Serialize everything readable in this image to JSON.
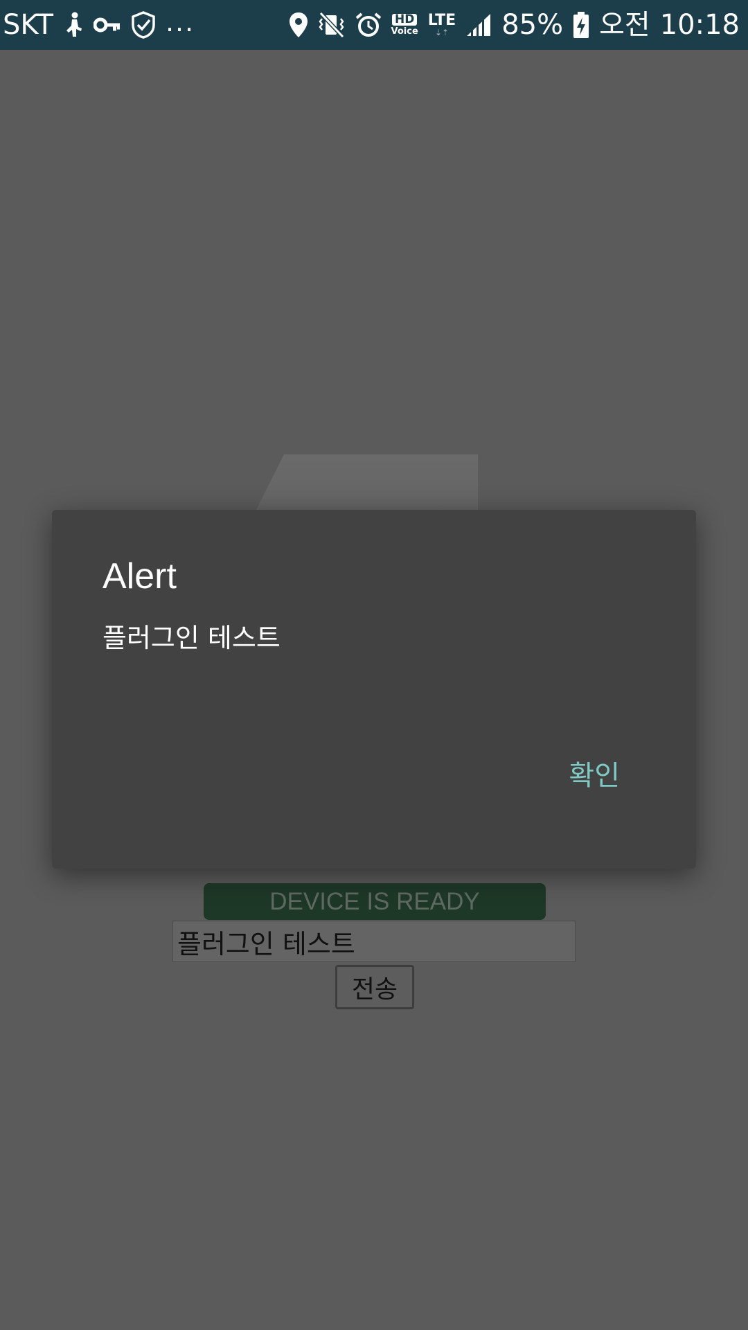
{
  "status_bar": {
    "carrier": "SKT",
    "overflow": "...",
    "battery_percent": "85%",
    "am_pm": "오전",
    "time": "10:18",
    "hd_label": "HD",
    "voice_label": "Voice",
    "lte_label": "LTE",
    "icons": [
      "walker-icon",
      "key-icon",
      "shield-check-icon",
      "location-pin-icon",
      "vibrate-mute-icon",
      "alarm-icon",
      "hd-voice-icon",
      "lte-icon",
      "signal-icon",
      "battery-charging-icon"
    ]
  },
  "app": {
    "device_status": "DEVICE IS READY",
    "input_value": "플러그인 테스트",
    "send_label": "전송"
  },
  "dialog": {
    "title": "Alert",
    "message": "플러그인 테스트",
    "ok_label": "확인",
    "ok_color": "#7fcbc4",
    "background": "#424242"
  },
  "colors": {
    "status_bar_bg": "#1c3d4a",
    "page_bg": "#5b5b5b",
    "device_ready_bg": "#1e3828"
  }
}
